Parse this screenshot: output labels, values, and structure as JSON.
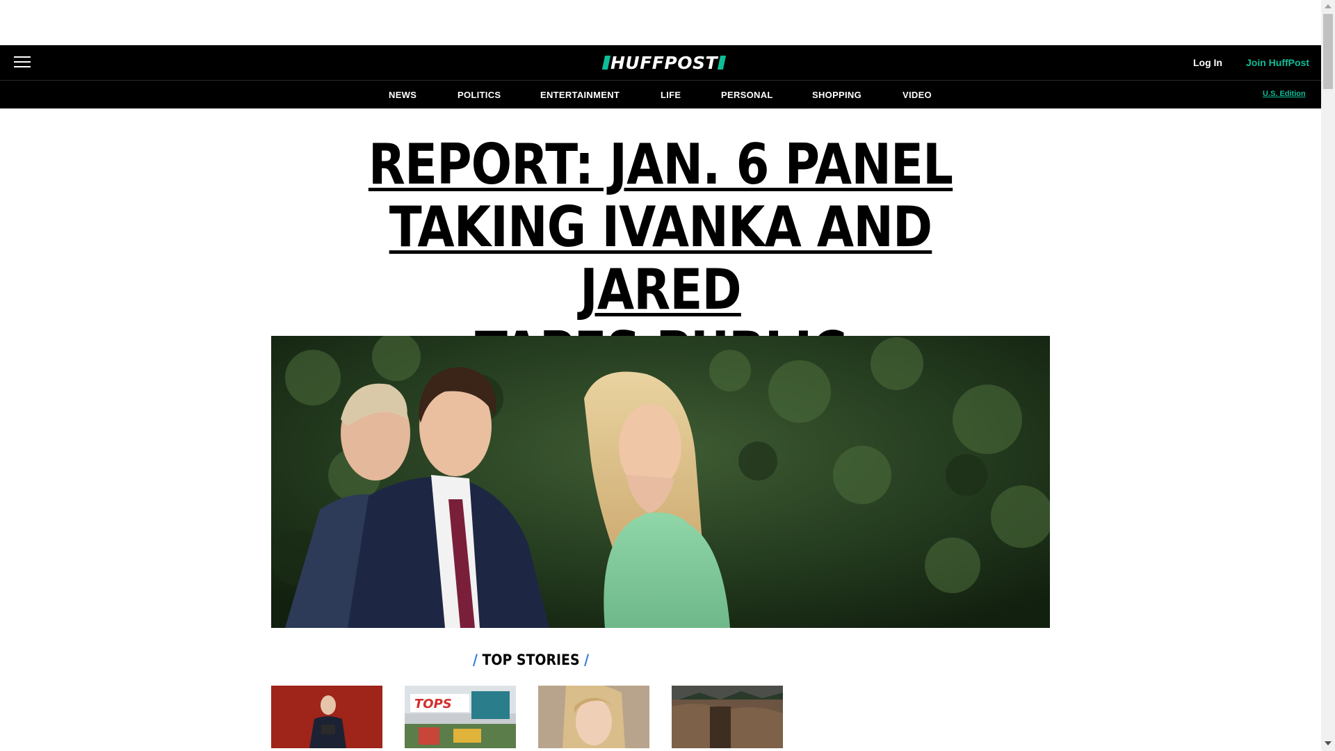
{
  "header": {
    "logo_text": "HUFFPOST",
    "login_label": "Log In",
    "join_label": "Join HuffPost",
    "menu_icon": "hamburger-icon"
  },
  "nav": {
    "items": [
      {
        "label": "NEWS"
      },
      {
        "label": "POLITICS"
      },
      {
        "label": "ENTERTAINMENT"
      },
      {
        "label": "LIFE"
      },
      {
        "label": "PERSONAL"
      },
      {
        "label": "SHOPPING"
      },
      {
        "label": "VIDEO"
      }
    ],
    "edition_label": "U.S. Edition"
  },
  "main": {
    "headline_lines": [
      "REPORT: JAN. 6 PANEL",
      "TAKING IVANKA AND JARED",
      "TAPES PUBLIC"
    ],
    "top_stories_label": "TOP STORIES"
  },
  "colors": {
    "brand_accent": "#0dbe98",
    "section_slash": "#2b7bd8",
    "header_bg": "#000000"
  }
}
